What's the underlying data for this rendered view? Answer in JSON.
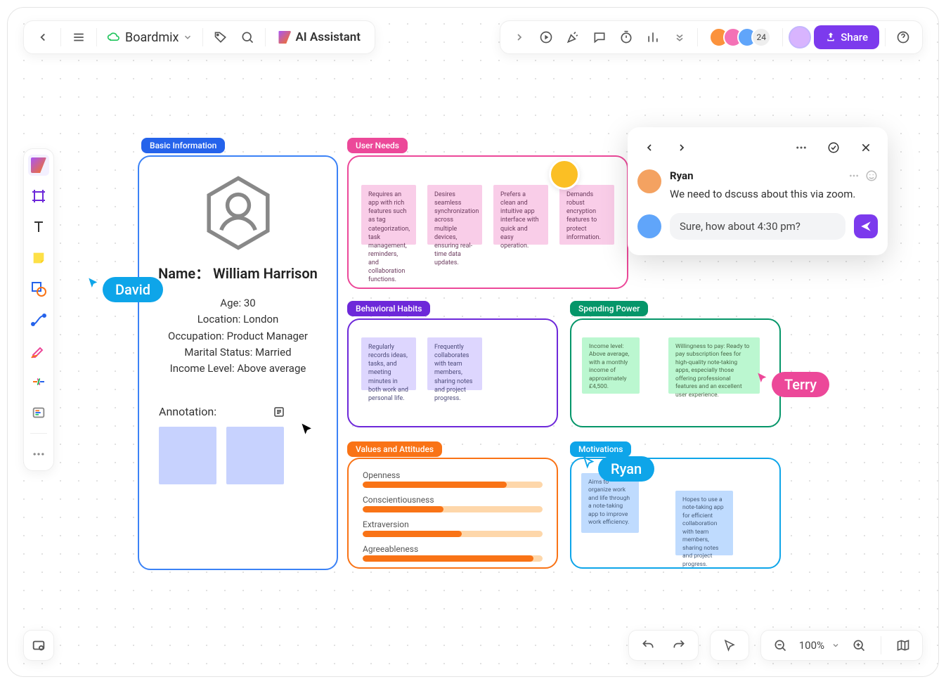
{
  "app": {
    "title": "Boardmix",
    "ai_label": "AI Assistant"
  },
  "collab": {
    "count": "24",
    "share_label": "Share"
  },
  "zoom": {
    "value": "100%"
  },
  "cursors": {
    "david": "David",
    "terry": "Terry",
    "ryan": "Ryan"
  },
  "persona": {
    "tag": "Basic Information",
    "name_line": "Name： William Harrison",
    "age": "Age: 30",
    "location": "Location: London",
    "occupation": "Occupation: Product Manager",
    "marital": "Marital Status: Married",
    "income": "Income Level: Above average",
    "annotation_label": "Annotation:"
  },
  "needs": {
    "tag": "User Needs",
    "s1": "Requires an app with rich features such as tag categorization, task management, reminders, and collaboration functions.",
    "s2": "Desires seamless synchronization across multiple devices, ensuring real-time data updates.",
    "s3": "Prefers a clean and intuitive app interface with quick and easy operation.",
    "s4": "Demands robust encryption features to protect information."
  },
  "habits": {
    "tag": "Behavioral Habits",
    "s1": "Regularly records ideas, tasks, and meeting minutes in both work and personal life.",
    "s2": "Frequently collaborates with team members, sharing notes and project progress."
  },
  "spending": {
    "tag": "Spending Power",
    "s1": "Income level: Above average, with a monthly income of approximately £4,500.",
    "s2": "Willingness to pay: Ready to pay subscription fees for high-quality note-taking apps, especially those offering professional features and an excellent user experience."
  },
  "values": {
    "tag": "Values and Attitudes",
    "r1": "Openness",
    "r2": "Conscientiousness",
    "r3": "Extraversion",
    "r4": "Agreeableness"
  },
  "motiv": {
    "tag": "Motivations",
    "s1": "Aims to organize work and life through a note-taking app to improve work efficiency.",
    "s2": "Hopes to use a note-taking app for efficient collaboration with team members, sharing notes and project progress."
  },
  "chat": {
    "name": "Ryan",
    "message": "We need to dscuss about this via zoom.",
    "reply": "Sure, how about 4:30 pm?"
  }
}
